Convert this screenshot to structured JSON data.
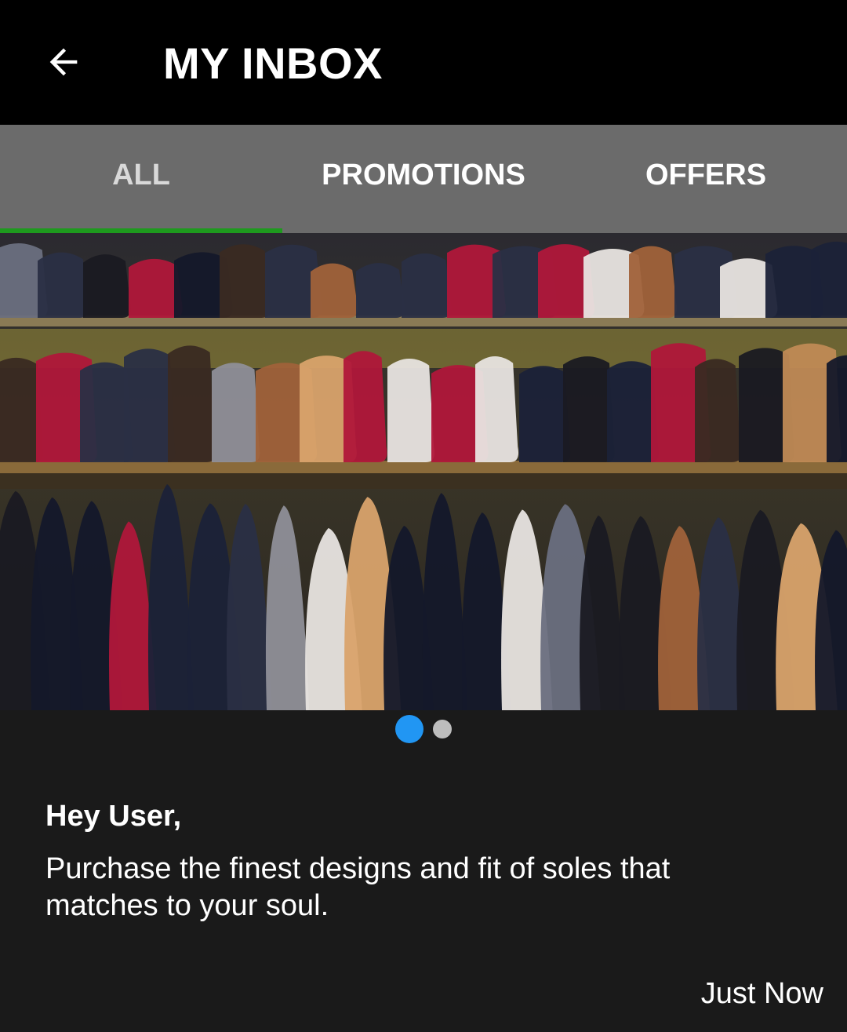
{
  "header": {
    "title": "MY INBOX",
    "back_icon": "arrow-left-icon"
  },
  "tabs": [
    {
      "label": "ALL",
      "active": true
    },
    {
      "label": "PROMOTIONS",
      "active": false
    },
    {
      "label": "OFFERS",
      "active": false
    }
  ],
  "banner": {
    "description_icon": "shoe-shelf-image",
    "slide_count": 2,
    "current_slide": 1
  },
  "message": {
    "greeting": "Hey User,",
    "body": "Purchase the finest designs and fit of soles that matches to your soul.",
    "time": "Just Now"
  },
  "colors": {
    "appbar_bg": "#000000",
    "tabbar_bg": "#6b6b6b",
    "tab_indicator": "#1e9a1e",
    "page_bg": "#1a1a1a",
    "dot_active": "#2196f3",
    "dot_inactive": "#bdbdbd"
  }
}
